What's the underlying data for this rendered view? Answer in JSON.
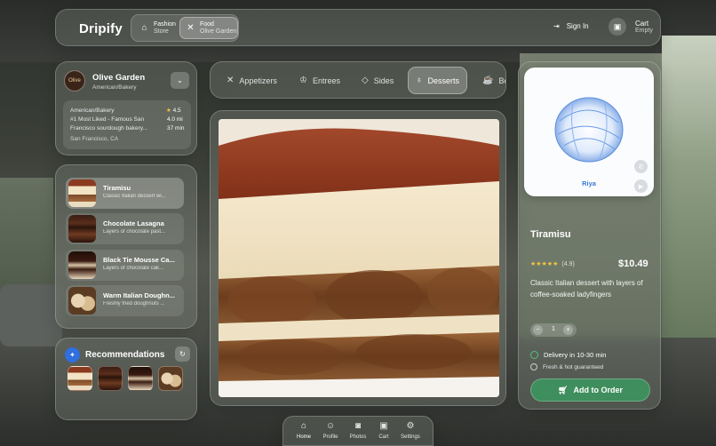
{
  "app": {
    "brand": "Dripify"
  },
  "stores": [
    {
      "name": "Fashion",
      "sub": "Store",
      "icon": "basket-icon"
    },
    {
      "name": "Food",
      "sub": "Olive Garden",
      "icon": "utensils-icon"
    }
  ],
  "header": {
    "sign_in": "Sign In",
    "cart_label": "Cart",
    "cart_status": "Empty"
  },
  "restaurant": {
    "logo_text": "Olive",
    "name": "Olive Garden",
    "category": "American/Bakery",
    "info_category": "American/Bakery",
    "tagline": "#1 Most Liked - Famous San Francisco sourdough bakery...",
    "rating": "4.5",
    "distance": "4.0 mi",
    "time": "37 min",
    "location": "San Francisco, CA"
  },
  "menu": [
    {
      "title": "Tiramisu",
      "desc": "Classic Italian dessert wi...",
      "thumb": "t-tira",
      "active": true
    },
    {
      "title": "Chocolate Lasagna",
      "desc": "Layers of chocolate past...",
      "thumb": "t-lasagna",
      "active": false
    },
    {
      "title": "Black Tie Mousse Ca...",
      "desc": "Layers of chocolate cak...",
      "thumb": "t-mousse",
      "active": false
    },
    {
      "title": "Warm Italian Doughn...",
      "desc": "Freshly fried doughnuts ...",
      "thumb": "t-dough",
      "active": false
    }
  ],
  "recommendations": {
    "title": "Recommendations"
  },
  "tabs": [
    {
      "label": "Appetizers",
      "icon": "utensils-icon",
      "active": false
    },
    {
      "label": "Entrees",
      "icon": "chef-hat-icon",
      "active": false
    },
    {
      "label": "Sides",
      "icon": "tag-icon",
      "active": false
    },
    {
      "label": "Desserts",
      "icon": "ice-cream-icon",
      "active": true
    },
    {
      "label": "Be",
      "icon": "coffee-icon",
      "active": false
    }
  ],
  "avatar": {
    "name": "Riya"
  },
  "product": {
    "title": "Tiramisu",
    "rating_stars": "★★★★★",
    "rating_count": "(4.9)",
    "price": "$10.49",
    "description": "Classic Italian dessert with layers of coffee-soaked ladyfingers",
    "quantity": "1",
    "minus": "−",
    "plus": "+",
    "delivery": "Delivery in 10-30 min",
    "fresh": "Fresh & hot guaranteed",
    "add_label": "Add to Order"
  },
  "bottom_nav": [
    {
      "label": "Home",
      "icon": "home-icon",
      "active": true
    },
    {
      "label": "Profile",
      "icon": "person-icon",
      "active": false
    },
    {
      "label": "Photos",
      "icon": "camera-icon",
      "active": false
    },
    {
      "label": "Cart",
      "icon": "bag-icon",
      "active": false
    },
    {
      "label": "Settings",
      "icon": "gear-icon",
      "active": false
    }
  ],
  "colors": {
    "accent_green": "#3f8e5d",
    "star": "#f5c542",
    "avatar_name": "#3b77d8",
    "rec_icon": "#2f6fe0"
  }
}
